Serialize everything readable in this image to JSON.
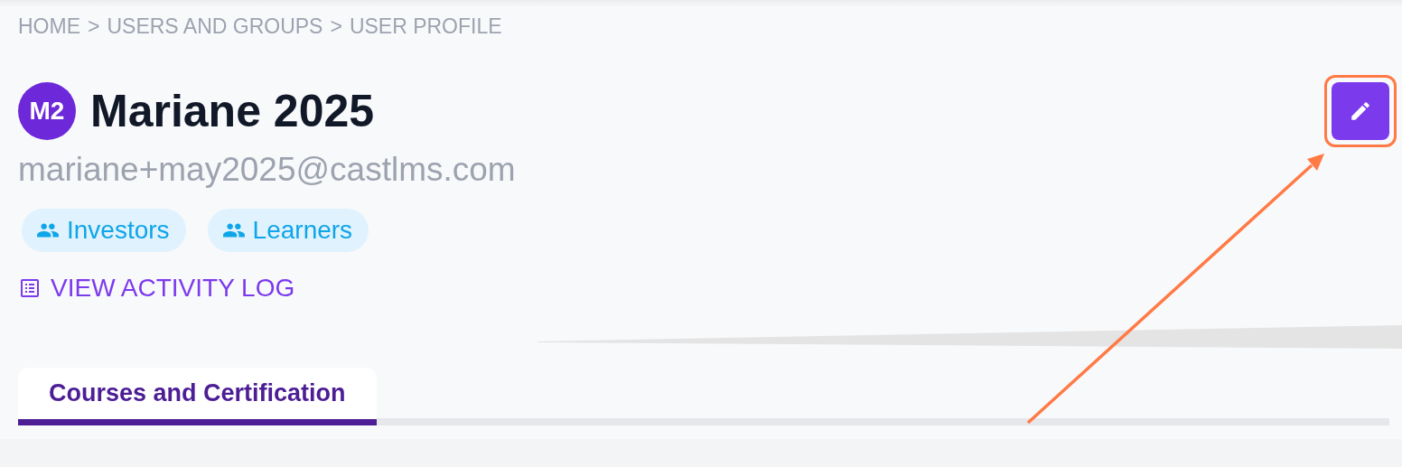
{
  "breadcrumb": [
    {
      "label": "HOME"
    },
    {
      "label": ">"
    },
    {
      "label": "USERS AND GROUPS"
    },
    {
      "label": ">"
    },
    {
      "label": "USER PROFILE"
    }
  ],
  "profile": {
    "initials": "M2",
    "name": "Mariane 2025",
    "email": "mariane+may2025@castlms.com"
  },
  "edit_button": {
    "highlighted": true
  },
  "groups": [
    {
      "label": "Investors"
    },
    {
      "label": "Learners"
    }
  ],
  "activity_link": {
    "label": "VIEW ACTIVITY LOG"
  },
  "tabs": [
    {
      "label": "Courses and Certification",
      "selected": true
    }
  ]
}
